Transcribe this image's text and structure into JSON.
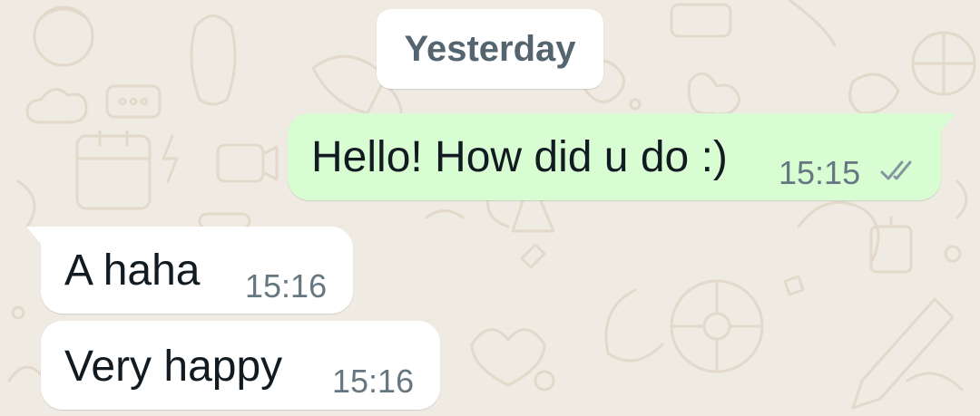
{
  "date_separator": "Yesterday",
  "messages": [
    {
      "direction": "outgoing",
      "text": "Hello! How did u do :)",
      "time": "15:15",
      "status_icon": "double-check-icon"
    },
    {
      "direction": "incoming",
      "text": "A haha",
      "time": "15:16"
    },
    {
      "direction": "incoming",
      "text": "Very happy",
      "time": "15:16"
    }
  ],
  "colors": {
    "background": "#efeae2",
    "outgoing_bubble": "#d9fdd3",
    "incoming_bubble": "#ffffff",
    "timestamp": "#667781",
    "date_chip_text": "#54656f"
  }
}
